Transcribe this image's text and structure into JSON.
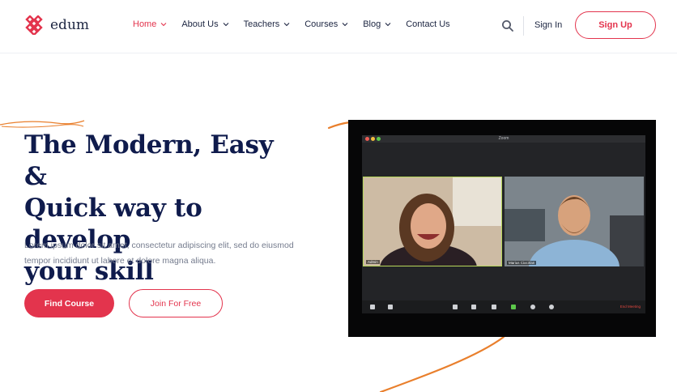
{
  "header": {
    "brand": "edum",
    "nav": [
      {
        "label": "Home",
        "active": true
      },
      {
        "label": "About Us"
      },
      {
        "label": "Teachers"
      },
      {
        "label": "Courses"
      },
      {
        "label": "Blog"
      },
      {
        "label": "Contact Us",
        "no_chevron": true
      }
    ],
    "signin": "Sign In",
    "signup": "Sign Up"
  },
  "hero": {
    "title_line1": "The Modern, Easy &",
    "title_line2": "Quick way to develop",
    "title_line3": "your skill",
    "desc_line1": "Lorem ipsum dolor sit amet, consectetur adipiscing elit, sed do eiusmod",
    "desc_line2": "tempor incididunt ut labore et dolore magna aliqua.",
    "primary_btn": "Find Course",
    "secondary_btn": "Join For Free"
  },
  "video": {
    "window_title": "Zoom",
    "participant1": "Admin",
    "participant2": "Marius Ciocirlan",
    "end_meeting": "End Meeting"
  },
  "colors": {
    "accent": "#e3344d",
    "navy": "#0f1b4c",
    "curve": "#e97f2c"
  }
}
